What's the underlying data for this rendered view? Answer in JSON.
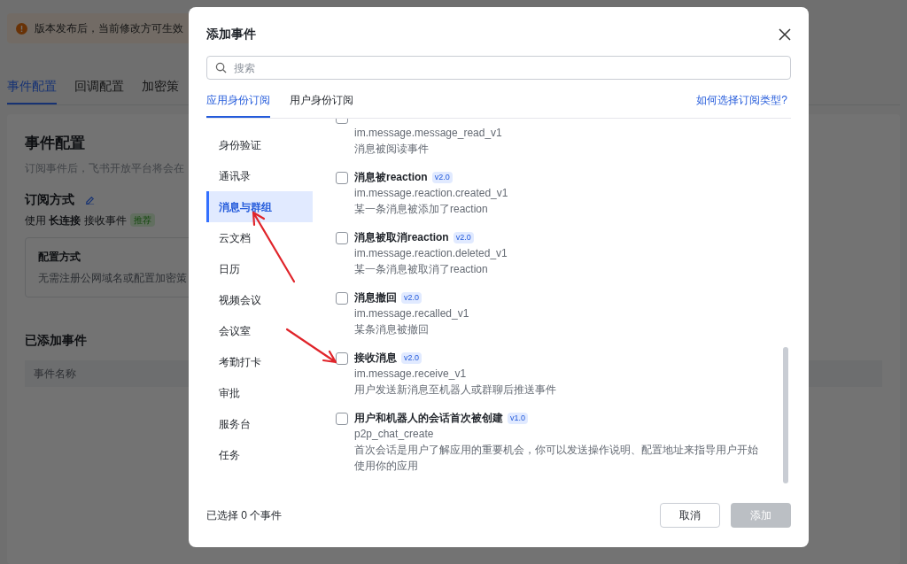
{
  "background": {
    "notice": "版本发布后，当前修改方可生效",
    "tabs": [
      {
        "label": "事件配置",
        "selected": true
      },
      {
        "label": "回调配置",
        "selected": false
      },
      {
        "label": "加密策",
        "selected": false
      }
    ],
    "section_title": "事件配置",
    "section_desc": "订阅事件后，飞书开放平台将会在",
    "subscribe_title": "订阅方式",
    "subscribe_text": "使用 **长连接** 接收事件",
    "subscribe_badge": "推荐",
    "config_title": "配置方式",
    "config_desc": "无需注册公网域名或配置加密策",
    "added_title": "已添加事件",
    "table_columns": [
      "事件名称"
    ]
  },
  "dialog": {
    "title": "添加事件",
    "search": {
      "placeholder": "搜索"
    },
    "tabs": [
      {
        "label": "应用身份订阅",
        "selected": true
      },
      {
        "label": "用户身份订阅",
        "selected": false
      }
    ],
    "help_link": "如何选择订阅类型?",
    "categories": [
      {
        "label": "身份验证",
        "selected": false
      },
      {
        "label": "通讯录",
        "selected": false
      },
      {
        "label": "消息与群组",
        "selected": true
      },
      {
        "label": "云文档",
        "selected": false
      },
      {
        "label": "日历",
        "selected": false
      },
      {
        "label": "视频会议",
        "selected": false
      },
      {
        "label": "会议室",
        "selected": false
      },
      {
        "label": "考勤打卡",
        "selected": false
      },
      {
        "label": "审批",
        "selected": false
      },
      {
        "label": "服务台",
        "selected": false
      },
      {
        "label": "任务",
        "selected": false
      }
    ],
    "events": [
      {
        "code": "im.message.message_read_v1",
        "desc": "消息被阅读事件",
        "checked": false
      },
      {
        "title": "消息被reaction",
        "version": "v2.0",
        "code": "im.message.reaction.created_v1",
        "desc": "某一条消息被添加了reaction",
        "checked": false
      },
      {
        "title": "消息被取消reaction",
        "version": "v2.0",
        "code": "im.message.reaction.deleted_v1",
        "desc": "某一条消息被取消了reaction",
        "checked": false
      },
      {
        "title": "消息撤回",
        "version": "v2.0",
        "code": "im.message.recalled_v1",
        "desc": "某条消息被撤回",
        "checked": false
      },
      {
        "title": "接收消息",
        "version": "v2.0",
        "code": "im.message.receive_v1",
        "desc": "用户发送新消息至机器人或群聊后推送事件",
        "checked": false
      },
      {
        "title": "用户和机器人的会话首次被创建",
        "version": "v1.0",
        "code": "p2p_chat_create",
        "desc": "首次会话是用户了解应用的重要机会，你可以发送操作说明、配置地址来指导用户开始使用你的应用",
        "checked": false
      }
    ],
    "selection_count": "已选择 0 个事件",
    "buttons": [
      {
        "label": "取消",
        "kind": "secondary",
        "disabled": false
      },
      {
        "label": "添加",
        "kind": "primary",
        "disabled": true
      }
    ]
  }
}
